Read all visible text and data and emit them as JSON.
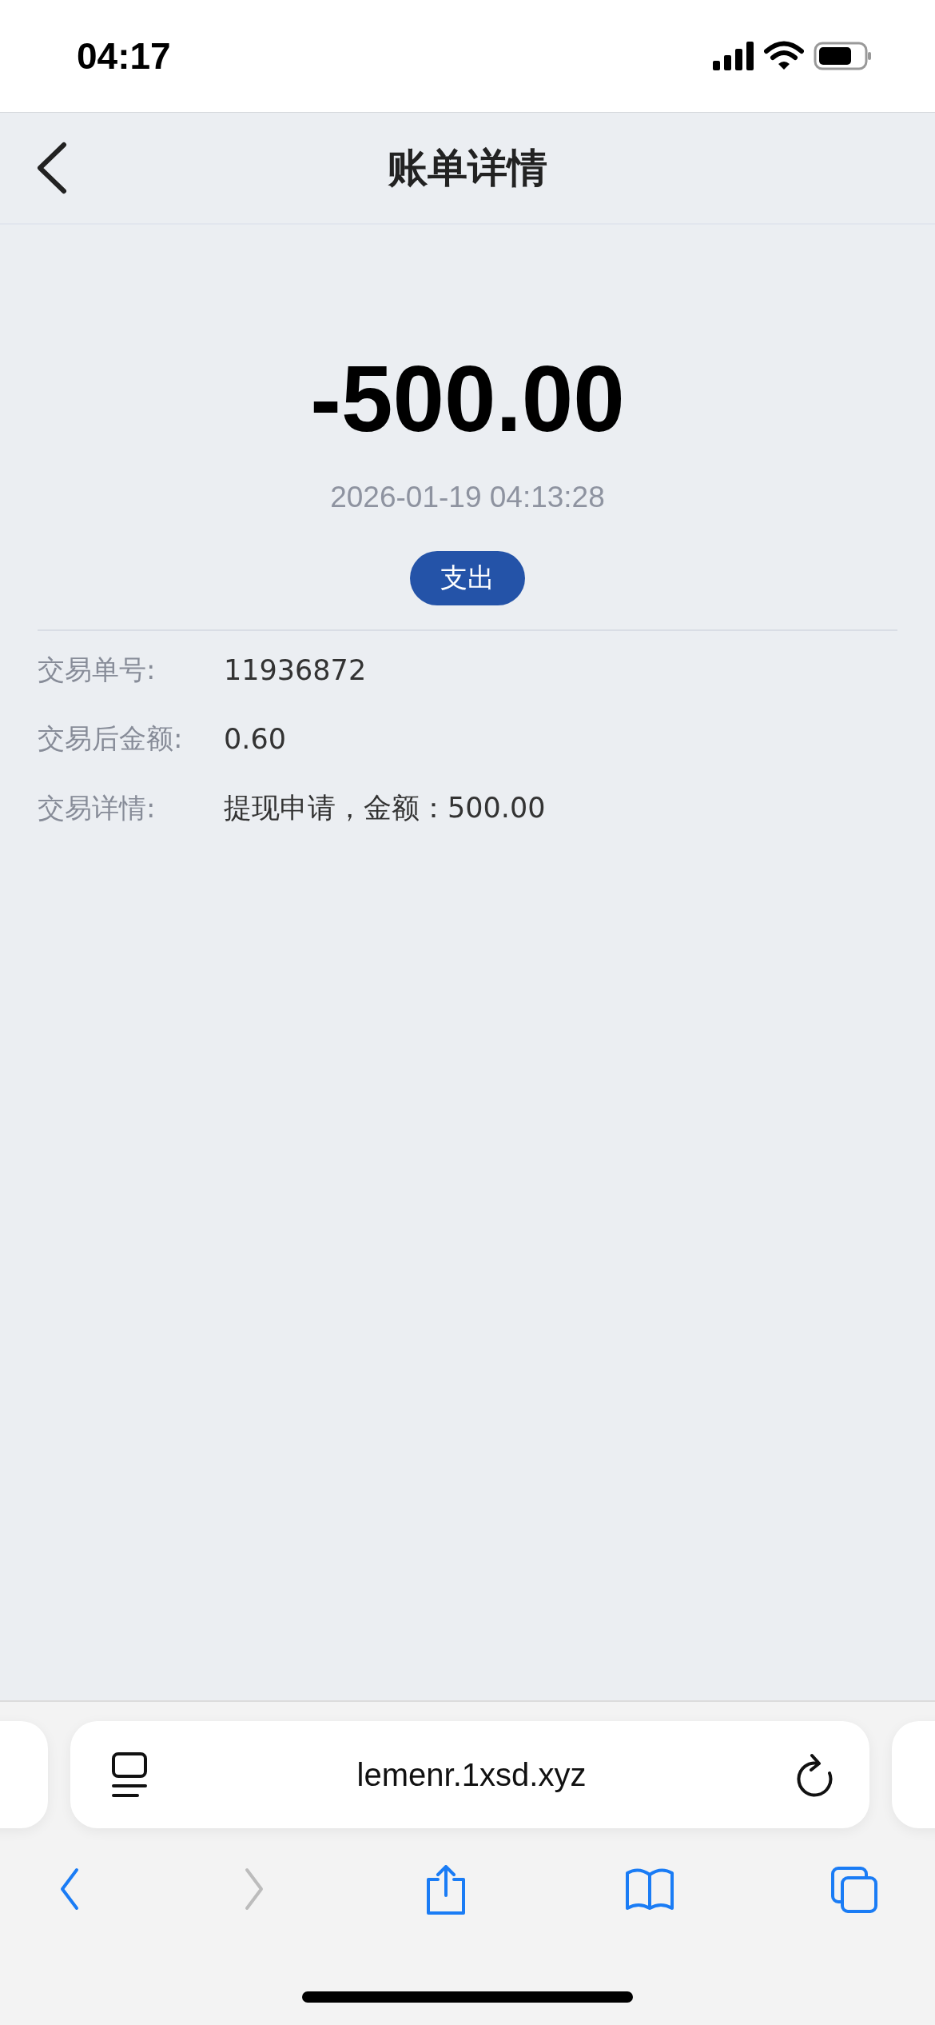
{
  "status_bar": {
    "time": "04:17"
  },
  "nav_bar": {
    "title": "账单详情"
  },
  "amount": "-500.00",
  "time": "2026-01-19 04:13:28",
  "type_badge": "支出",
  "details": [
    {
      "label": "交易单号:",
      "value": "11936872"
    },
    {
      "label": "交易后金额:",
      "value": "0.60"
    },
    {
      "label": "交易详情:",
      "value": "提现申请，金额：500.00"
    }
  ],
  "browser": {
    "url": "lemenr.1xsd.xyz",
    "toolbar": [
      {
        "kind": "back",
        "disabled": false
      },
      {
        "kind": "forward",
        "disabled": true
      },
      {
        "kind": "share",
        "disabled": false
      },
      {
        "kind": "bookmarks",
        "disabled": false
      },
      {
        "kind": "tabs",
        "disabled": false
      }
    ]
  }
}
